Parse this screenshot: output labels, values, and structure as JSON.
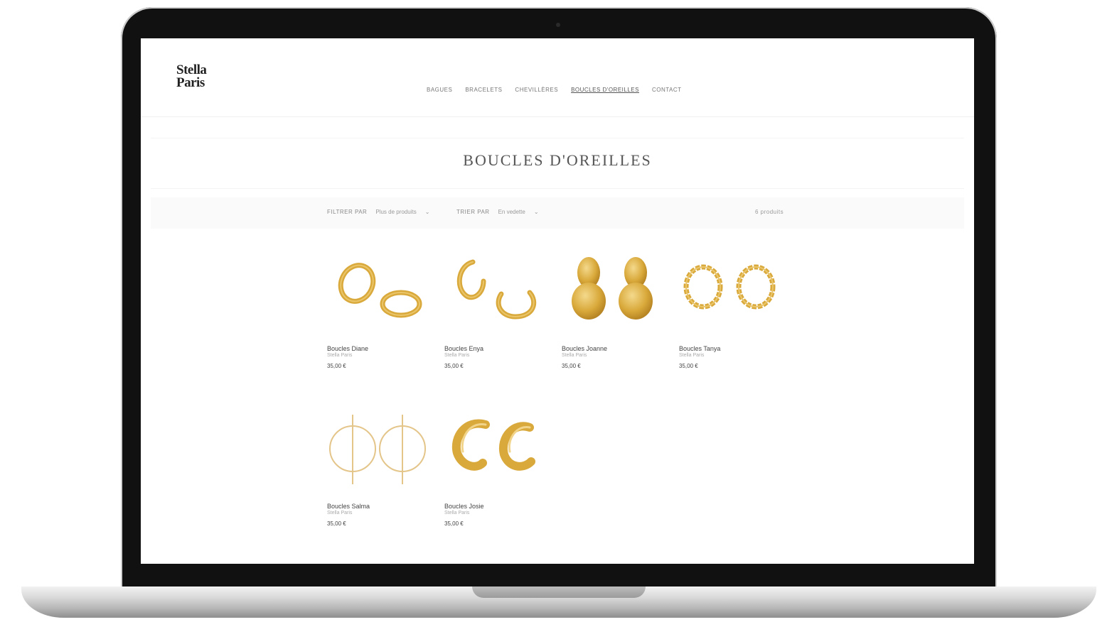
{
  "site": {
    "logo_line1": "Stella",
    "logo_line2": "Paris"
  },
  "nav": {
    "items": [
      {
        "label": "Bagues"
      },
      {
        "label": "Bracelets"
      },
      {
        "label": "Chevillères"
      },
      {
        "label": "Boucles d'oreilles",
        "active": true
      },
      {
        "label": "Contact"
      }
    ]
  },
  "page": {
    "title": "BOUCLES D'OREILLES"
  },
  "filters": {
    "filter_label": "Filtrer par",
    "filter_value": "Plus de produits",
    "sort_label": "Trier par",
    "sort_value": "En vedette",
    "count": "6 produits"
  },
  "products": [
    {
      "name": "Boucles Diane",
      "sub": "Stella Paris",
      "price": "35,00 €",
      "icon": "hoop-earrings"
    },
    {
      "name": "Boucles Enya",
      "sub": "Stella Paris",
      "price": "35,00 €",
      "icon": "open-hoop-earrings"
    },
    {
      "name": "Boucles Joanne",
      "sub": "Stella Paris",
      "price": "35,00 €",
      "icon": "disc-drop-earrings"
    },
    {
      "name": "Boucles Tanya",
      "sub": "Stella Paris",
      "price": "35,00 €",
      "icon": "twisted-hoop-earrings"
    },
    {
      "name": "Boucles Salma",
      "sub": "Stella Paris",
      "price": "35,00 €",
      "icon": "circle-bar-earrings"
    },
    {
      "name": "Boucles Josie",
      "sub": "Stella Paris",
      "price": "35,00 €",
      "icon": "chunky-hoop-earrings"
    }
  ],
  "colors": {
    "gold": "#d9a93b",
    "gold_light": "#eac56a",
    "gold_dark": "#b07e1f"
  }
}
